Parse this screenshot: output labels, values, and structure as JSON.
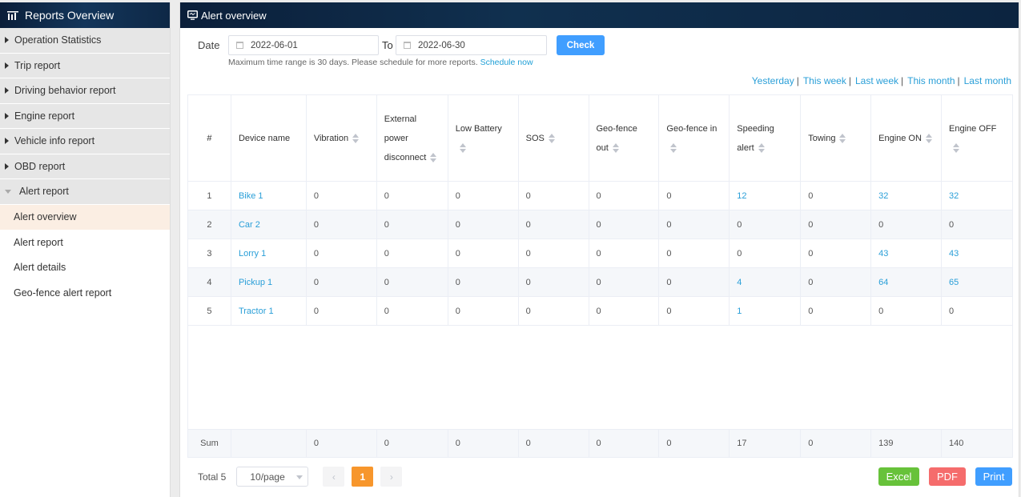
{
  "sidebar": {
    "title": "Reports Overview",
    "items": [
      {
        "label": "Operation Statistics"
      },
      {
        "label": "Trip report"
      },
      {
        "label": "Driving behavior report"
      },
      {
        "label": "Engine report"
      },
      {
        "label": "Vehicle info report"
      },
      {
        "label": "OBD report"
      },
      {
        "label": "Alert report"
      }
    ],
    "sub_items": [
      {
        "label": "Alert overview",
        "active": true
      },
      {
        "label": "Alert report"
      },
      {
        "label": "Alert details"
      },
      {
        "label": "Geo-fence alert report"
      }
    ]
  },
  "main": {
    "title": "Alert overview",
    "filter": {
      "date_label": "Date",
      "from": "2022-06-01",
      "to_label": "To",
      "to": "2022-06-30",
      "check_label": "Check",
      "hint": "Maximum time range is 30 days. Please schedule for more reports.",
      "schedule_link": "Schedule now"
    },
    "quick": [
      "Yesterday",
      "This week",
      "Last week",
      "This month",
      "Last month"
    ],
    "table": {
      "headers": [
        "#",
        "Device name",
        "Vibration",
        "External power disconnect",
        "Low Battery",
        "SOS",
        "Geo-fence out",
        "Geo-fence in",
        "Speeding alert",
        "Towing",
        "Engine ON",
        "Engine OFF"
      ],
      "rows": [
        [
          "1",
          "Bike 1",
          "0",
          "0",
          "0",
          "0",
          "0",
          "0",
          "12",
          "0",
          "32",
          "32"
        ],
        [
          "2",
          "Car 2",
          "0",
          "0",
          "0",
          "0",
          "0",
          "0",
          "0",
          "0",
          "0",
          "0"
        ],
        [
          "3",
          "Lorry 1",
          "0",
          "0",
          "0",
          "0",
          "0",
          "0",
          "0",
          "0",
          "43",
          "43"
        ],
        [
          "4",
          "Pickup 1",
          "0",
          "0",
          "0",
          "0",
          "0",
          "0",
          "4",
          "0",
          "64",
          "65"
        ],
        [
          "5",
          "Tractor 1",
          "0",
          "0",
          "0",
          "0",
          "0",
          "0",
          "1",
          "0",
          "0",
          "0"
        ]
      ],
      "sum": [
        "Sum",
        "",
        "0",
        "0",
        "0",
        "0",
        "0",
        "0",
        "17",
        "0",
        "139",
        "140"
      ]
    },
    "pager": {
      "total": "Total 5",
      "page_size": "10/page",
      "current": "1",
      "prev": "‹",
      "next": "›"
    },
    "exports": {
      "excel": "Excel",
      "pdf": "PDF",
      "print": "Print"
    }
  }
}
